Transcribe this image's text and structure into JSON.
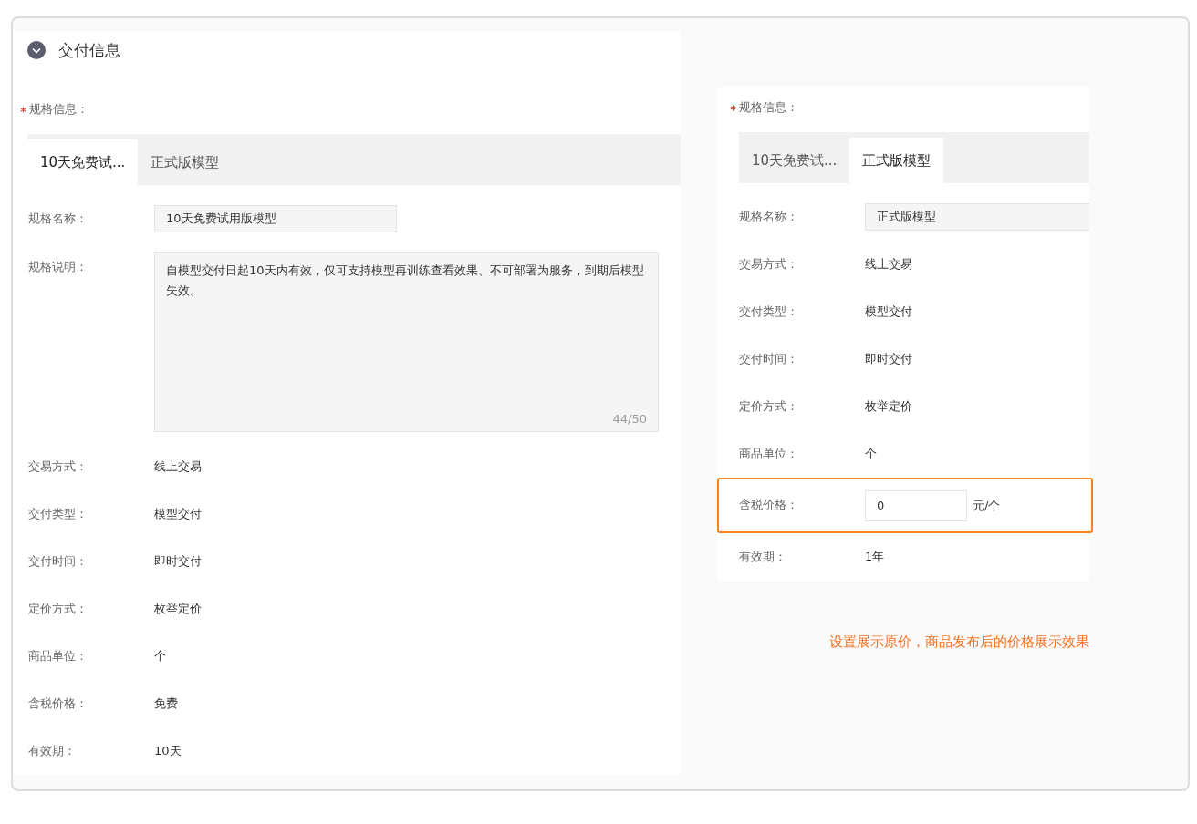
{
  "section": {
    "title": "交付信息",
    "expanded": true
  },
  "left_panel": {
    "spec": {
      "label": "规格信息：",
      "required": true
    },
    "tabs": [
      {
        "label": "10天免费试...",
        "selected": true
      },
      {
        "label": "正式版模型",
        "selected": false
      }
    ],
    "fields": [
      {
        "kind": "input",
        "label": "规格名称：",
        "value": "10天免费试用版模型"
      },
      {
        "kind": "textarea",
        "label": "规格说明：",
        "value": "自模型交付日起10天内有效，仅可支持模型再训练查看效果、不可部署为服务，到期后模型失效。",
        "counter": "44/50"
      },
      {
        "kind": "text",
        "label": "交易方式：",
        "value": "线上交易"
      },
      {
        "kind": "text",
        "label": "交付类型：",
        "value": "模型交付"
      },
      {
        "kind": "text",
        "label": "交付时间：",
        "value": "即时交付"
      },
      {
        "kind": "text",
        "label": "定价方式：",
        "value": "枚举定价"
      },
      {
        "kind": "text",
        "label": "商品单位：",
        "value": "个"
      },
      {
        "kind": "text",
        "label": "含税价格：",
        "value": "免费"
      },
      {
        "kind": "text",
        "label": "有效期：",
        "value": "10天"
      }
    ]
  },
  "right_panel": {
    "spec": {
      "label": "规格信息：",
      "required": true
    },
    "tabs": [
      {
        "label": "10天免费试...",
        "selected": false
      },
      {
        "label": "正式版模型",
        "selected": true
      }
    ],
    "fields": [
      {
        "kind": "input",
        "label": "规格名称：",
        "value": "正式版模型"
      },
      {
        "kind": "text",
        "label": "交易方式：",
        "value": "线上交易"
      },
      {
        "kind": "text",
        "label": "交付类型：",
        "value": "模型交付"
      },
      {
        "kind": "text",
        "label": "交付时间：",
        "value": "即时交付"
      },
      {
        "kind": "text",
        "label": "定价方式：",
        "value": "枚举定价"
      },
      {
        "kind": "text",
        "label": "商品单位：",
        "value": "个"
      },
      {
        "kind": "price",
        "label": "含税价格：",
        "value": "0",
        "unit": "元/个",
        "highlighted": true
      },
      {
        "kind": "text",
        "label": "有效期：",
        "value": "1年"
      }
    ]
  },
  "caption": "设置展示原价，商品发布后的价格展示效果"
}
